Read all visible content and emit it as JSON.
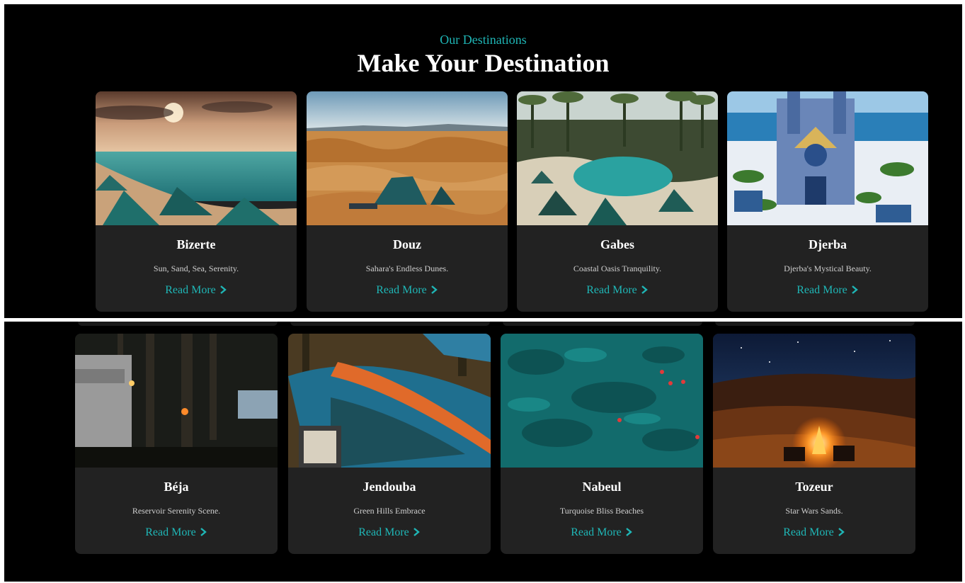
{
  "section": {
    "eyebrow": "Our Destinations",
    "title": "Make Your Destination"
  },
  "colors": {
    "accent": "#1fb6b6",
    "card_bg": "#222222",
    "page_bg": "#000000"
  },
  "read_more_label": "Read More",
  "read_more_icon": "chevron-right-icon",
  "destinations_row1": [
    {
      "name": "Bizerte",
      "tagline": "Sun, Sand, Sea, Serenity.",
      "image": "beach-camping-sunset"
    },
    {
      "name": "Douz",
      "tagline": "Sahara's Endless Dunes.",
      "image": "desert-tent-dunes"
    },
    {
      "name": "Gabes",
      "tagline": "Coastal Oasis Tranquility.",
      "image": "oasis-palms-tents"
    },
    {
      "name": "Djerba",
      "tagline": "Djerba's Mystical Beauty.",
      "image": "blue-white-architecture"
    }
  ],
  "destinations_row2": [
    {
      "name": "Béja",
      "tagline": "Reservoir Serenity Scene.",
      "image": "forest-campervan-lake"
    },
    {
      "name": "Jendouba",
      "tagline": "Green Hills Embrace",
      "image": "hammock-ereader"
    },
    {
      "name": "Nabeul",
      "tagline": "Turquoise Bliss Beaches",
      "image": "aerial-turquoise-swimmers"
    },
    {
      "name": "Tozeur",
      "tagline": "Star Wars Sands.",
      "image": "desert-night-campfire"
    }
  ]
}
